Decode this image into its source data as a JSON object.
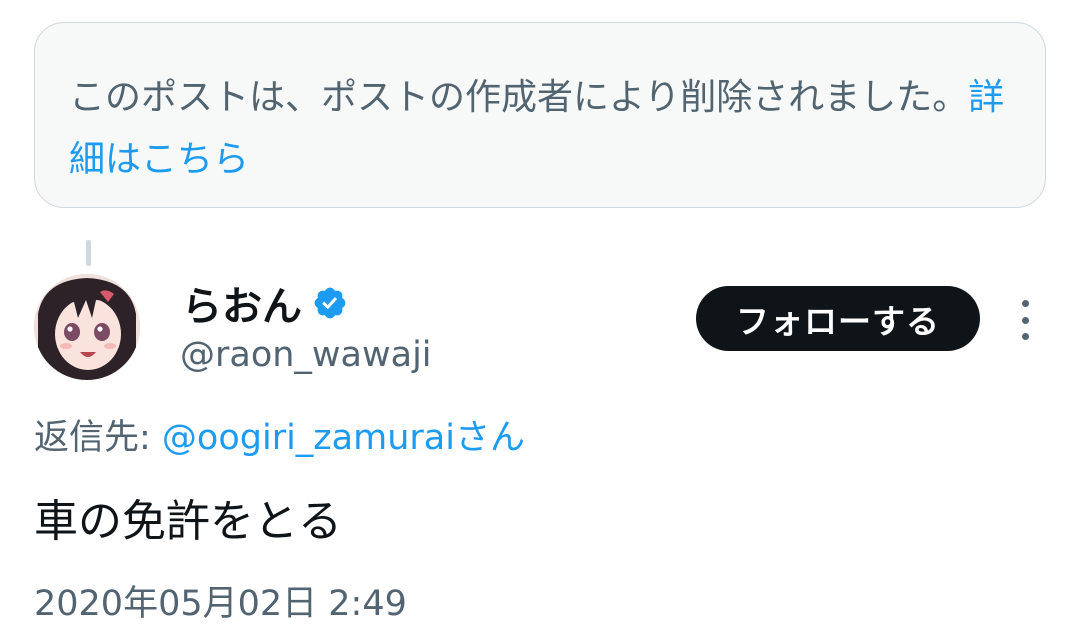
{
  "deleted_notice": {
    "text": "このポストは、ポストの作成者により削除されました。",
    "link_label": "詳細はこちら"
  },
  "author": {
    "display_name": "らおん",
    "handle": "@raon_wawaji",
    "verified": true,
    "verified_color": "#1d9bf0"
  },
  "actions": {
    "follow_label": "フォローする"
  },
  "reply": {
    "prefix": "返信先: ",
    "mention": "@oogiri_zamurai",
    "suffix": "さん"
  },
  "tweet": {
    "text": "車の免許をとる",
    "timestamp": "2020年05月02日 2:49"
  },
  "colors": {
    "accent": "#1d9bf0",
    "text_primary": "#0f1419",
    "text_secondary": "#536471",
    "border": "#cfd9de",
    "button_bg": "#0f1419"
  }
}
